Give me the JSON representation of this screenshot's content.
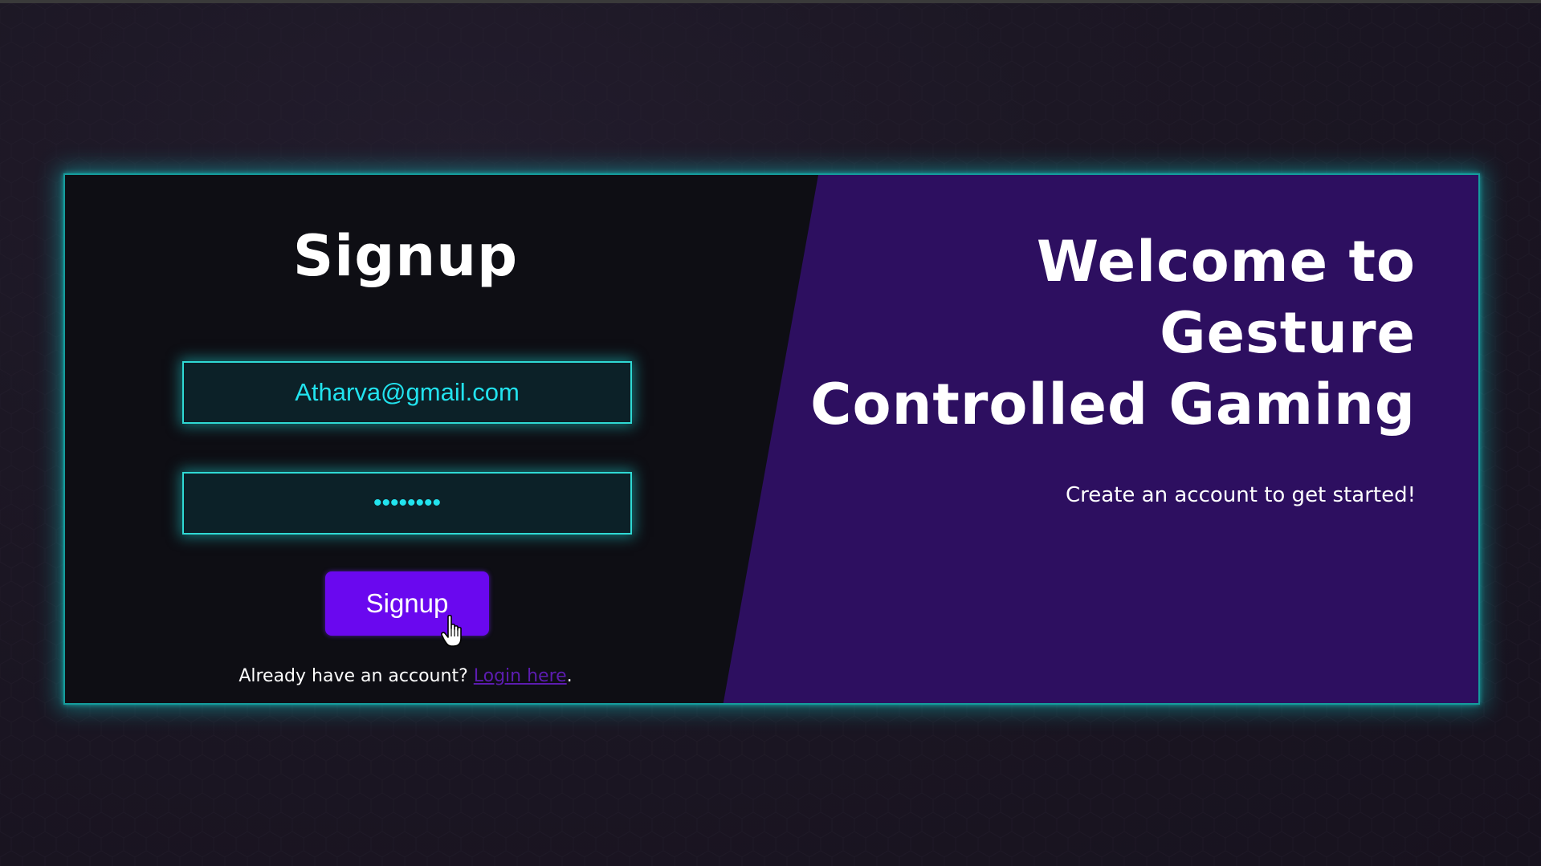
{
  "colors": {
    "background": "#1c1724",
    "card_left": "#0e0e14",
    "card_right": "#2d0f60",
    "glow": "#2fd9d4",
    "input_text": "#22e3ee",
    "button": "#6a08ef",
    "link": "#5c1cb0"
  },
  "signup_form": {
    "title": "Signup",
    "email_value": "Atharva@gmail.com",
    "password_masked": "••••••••",
    "button_label": "Signup",
    "login_prompt": "Already have an account? ",
    "login_link_label": "Login here",
    "login_suffix": "."
  },
  "welcome": {
    "title_line1": "Welcome to",
    "title_line2": "Gesture",
    "title_line3": "Controlled Gaming",
    "subtitle": "Create an account to get started!"
  },
  "icons": {
    "cursor": "hand-pointer-icon"
  }
}
